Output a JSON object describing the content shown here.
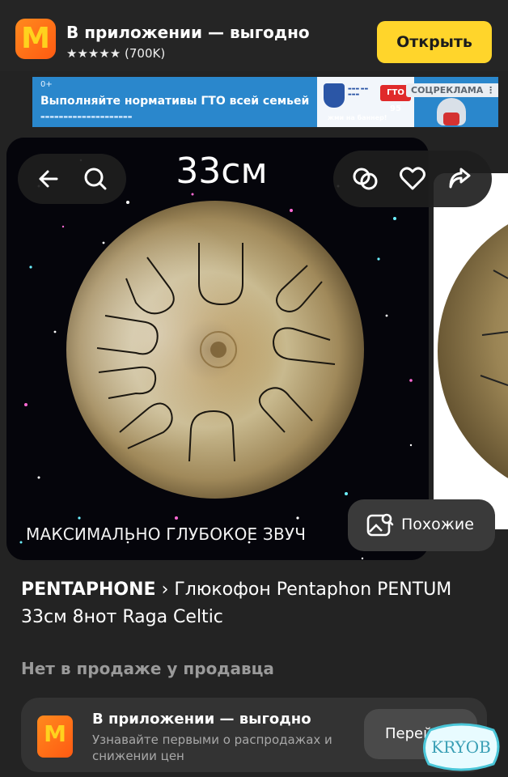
{
  "app_banner": {
    "logo_glyph": "M",
    "title": "В приложении — выгодно",
    "rating": "★★★★★ (700K)",
    "open_label": "Открыть"
  },
  "ad": {
    "age": "0+",
    "text": "Выполняйте нормативы ГТО всей семьей",
    "gto": "ГТО 95",
    "cta": "жми на баннер!",
    "label": "СОЦРЕКЛАМА ⋮"
  },
  "hero": {
    "size_label": "33см",
    "caption": "МАКСИМАЛЬНО ГЛУБОКОЕ ЗВУЧ",
    "similar_label": "Похожие"
  },
  "product": {
    "brand": "PENTAPHONE",
    "separator": " › ",
    "name": "Глюкофон Pentaphon PENTUM 33см 8нот Raga Celtic",
    "status": "Нет в продаже у продавца"
  },
  "promo": {
    "logo_glyph": "M",
    "title": "В приложении — выгодно",
    "subtitle": "Узнавайте первыми о распродажах и снижении цен",
    "button_label": "Перейти"
  },
  "watermark": "KRYOB",
  "icons": [
    "back-arrow-icon",
    "search-icon",
    "compare-icon",
    "heart-icon",
    "share-icon",
    "image-search-icon"
  ],
  "colors": {
    "accent": "#ffd52b",
    "background": "#232323",
    "ad_blue": "#2a87cc"
  }
}
